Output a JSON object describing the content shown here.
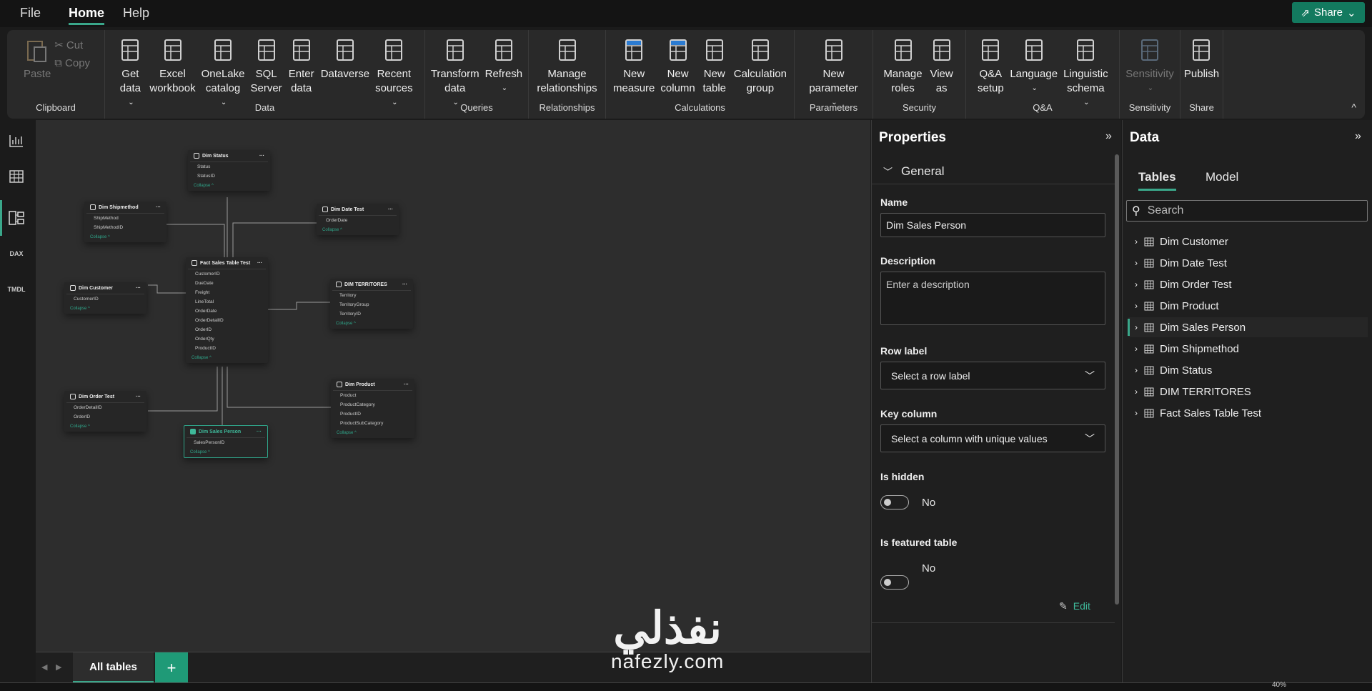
{
  "menu": {
    "items": [
      "File",
      "Home",
      "Help"
    ],
    "share_label": "Share"
  },
  "ribbon": {
    "clipboard": {
      "label": "Clipboard",
      "paste": "Paste",
      "cut": "Cut",
      "copy": "Copy"
    },
    "groups": [
      {
        "label": "Data",
        "buttons": [
          {
            "label": "Get\ndata",
            "icon": "database-icon",
            "dropdown": true
          },
          {
            "label": "Excel\nworkbook",
            "icon": "excel-icon"
          },
          {
            "label": "OneLake\ncatalog",
            "icon": "onelake-icon",
            "dropdown": true
          },
          {
            "label": "SQL\nServer",
            "icon": "sql-server-icon"
          },
          {
            "label": "Enter\ndata",
            "icon": "enter-data-icon"
          },
          {
            "label": "Dataverse",
            "icon": "dataverse-icon"
          },
          {
            "label": "Recent\nsources",
            "icon": "recent-sources-icon",
            "dropdown": true
          }
        ]
      },
      {
        "label": "Queries",
        "buttons": [
          {
            "label": "Transform\ndata",
            "icon": "transform-icon",
            "dropdown": true
          },
          {
            "label": "Refresh\n",
            "icon": "refresh-icon",
            "dropdown": true
          }
        ]
      },
      {
        "label": "Relationships",
        "buttons": [
          {
            "label": "Manage\nrelationships",
            "icon": "relationships-icon"
          }
        ]
      },
      {
        "label": "Calculations",
        "buttons": [
          {
            "label": "New\nmeasure",
            "icon": "calculator-icon"
          },
          {
            "label": "New\ncolumn",
            "icon": "new-column-icon"
          },
          {
            "label": "New\ntable",
            "icon": "new-table-icon"
          },
          {
            "label": "Calculation\ngroup",
            "icon": "calculation-group-icon"
          }
        ]
      },
      {
        "label": "Parameters",
        "buttons": [
          {
            "label": "New\nparameter",
            "icon": "parameter-icon",
            "dropdown": true
          }
        ]
      },
      {
        "label": "Security",
        "buttons": [
          {
            "label": "Manage\nroles",
            "icon": "manage-roles-icon"
          },
          {
            "label": "View\nas",
            "icon": "view-as-icon"
          }
        ]
      },
      {
        "label": "Q&A",
        "buttons": [
          {
            "label": "Q&A\nsetup",
            "icon": "qa-setup-icon"
          },
          {
            "label": "Language\n",
            "icon": "language-icon",
            "dropdown": true
          },
          {
            "label": "Linguistic\nschema",
            "icon": "linguistic-icon",
            "dropdown": true
          }
        ]
      },
      {
        "label": "Sensitivity",
        "buttons": [
          {
            "label": "Sensitivity\n",
            "icon": "sensitivity-icon",
            "dropdown": true,
            "disabled": true
          }
        ]
      },
      {
        "label": "Share",
        "buttons": [
          {
            "label": "Publish",
            "icon": "publish-icon"
          }
        ]
      }
    ]
  },
  "rail": {
    "dax": "DAX",
    "tmdl": "TMDL"
  },
  "model": {
    "tables": [
      {
        "name": "Dim Status",
        "columns": [
          "Status",
          "StatusID"
        ]
      },
      {
        "name": "Dim Shipmethod",
        "columns": [
          "ShipMethod",
          "ShipMethodID"
        ]
      },
      {
        "name": "Dim Date Test",
        "columns": [
          "OrderDate"
        ]
      },
      {
        "name": "Fact Sales Table Test",
        "columns": [
          "CustomerID",
          "DueDate",
          "Freight",
          "LineTotal",
          "OrderDate",
          "OrderDetailID",
          "OrderID",
          "OrderQty",
          "ProductID"
        ]
      },
      {
        "name": "Dim Customer",
        "columns": [
          "CustomerID"
        ]
      },
      {
        "name": "DIM TERRITORES",
        "columns": [
          "Territory",
          "TerritoryGroup",
          "TerritoryID"
        ]
      },
      {
        "name": "Dim Order Test",
        "columns": [
          "OrderDetailID",
          "OrderID"
        ]
      },
      {
        "name": "Dim Sales Person",
        "columns": [
          "SalesPersonID"
        ],
        "selected": true
      },
      {
        "name": "Dim Product",
        "columns": [
          "Product",
          "ProductCategory",
          "ProductID",
          "ProductSubCategory"
        ]
      }
    ],
    "collapse_label": "Collapse ^",
    "tab_label": "All tables",
    "add_tab": "+"
  },
  "properties": {
    "title": "Properties",
    "section": "General",
    "name_label": "Name",
    "name_value": "Dim Sales Person",
    "description_label": "Description",
    "description_placeholder": "Enter a description",
    "row_label_label": "Row label",
    "row_label_value": "Select a row label",
    "key_column_label": "Key column",
    "key_column_value": "Select a column with unique values",
    "is_hidden_label": "Is hidden",
    "is_hidden_value": "No",
    "is_featured_label": "Is featured table",
    "is_featured_value": "No",
    "edit_label": "Edit"
  },
  "data_pane": {
    "title": "Data",
    "tabs": [
      "Tables",
      "Model"
    ],
    "search_placeholder": "Search",
    "tables": [
      "Dim Customer",
      "Dim Date Test",
      "Dim Order Test",
      "Dim Product",
      "Dim Sales Person",
      "Dim Shipmethod",
      "Dim Status",
      "DIM TERRITORES",
      "Fact Sales Table Test"
    ],
    "selected": "Dim Sales Person"
  },
  "status": {
    "zoom": "40%"
  },
  "watermark": {
    "arabic": "نفذلي",
    "latin": "nafezly.com"
  },
  "colors": {
    "accent": "#3aa78a",
    "share": "#137a5f"
  }
}
